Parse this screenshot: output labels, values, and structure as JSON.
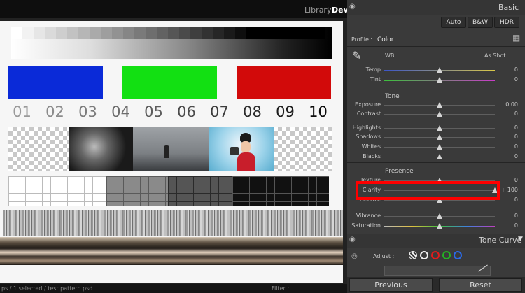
{
  "topbar": {
    "modules": [
      "Library",
      "Deve"
    ],
    "separator": "|"
  },
  "canvas": {
    "numbers": [
      "01",
      "02",
      "03",
      "04",
      "05",
      "06",
      "07",
      "08",
      "09",
      "10"
    ]
  },
  "bottom": {
    "left_text": "ps / 1 selected / test pattern.psd",
    "filter_label": "Filter :"
  },
  "panel": {
    "title": "Basic",
    "treatment": {
      "auto": "Auto",
      "bw": "B&W",
      "hdr": "HDR"
    },
    "profile": {
      "label": "Profile :",
      "value": "Color"
    },
    "wb": {
      "label": "WB :",
      "value": "As Shot"
    },
    "sliders_wb": [
      {
        "label": "Temp",
        "value": "0",
        "level": 0.5
      },
      {
        "label": "Tint",
        "value": "0",
        "level": 0.5
      }
    ],
    "tone_title": "Tone",
    "sliders_tone": [
      {
        "label": "Exposure",
        "value": "0.00",
        "level": 0.5
      },
      {
        "label": "Contrast",
        "value": "0",
        "level": 0.5
      },
      {
        "label": "Highlights",
        "value": "0",
        "level": 0.5
      },
      {
        "label": "Shadows",
        "value": "0",
        "level": 0.5
      },
      {
        "label": "Whites",
        "value": "0",
        "level": 0.5
      },
      {
        "label": "Blacks",
        "value": "0",
        "level": 0.5
      }
    ],
    "presence_title": "Presence",
    "sliders_presence": [
      {
        "label": "Texture",
        "value": "0",
        "level": 0.5
      },
      {
        "label": "Clarity",
        "value": "+ 100",
        "level": 1.0
      },
      {
        "label": "Dehaze",
        "value": "0",
        "level": 0.5
      },
      {
        "label": "Vibrance",
        "value": "0",
        "level": 0.5
      },
      {
        "label": "Saturation",
        "value": "0",
        "level": 0.5
      }
    ],
    "tone_curve_title": "Tone Curve",
    "adjust_label": "Adjust :",
    "previous": "Previous",
    "reset": "Reset",
    "highlight_color": "#ff0000"
  }
}
